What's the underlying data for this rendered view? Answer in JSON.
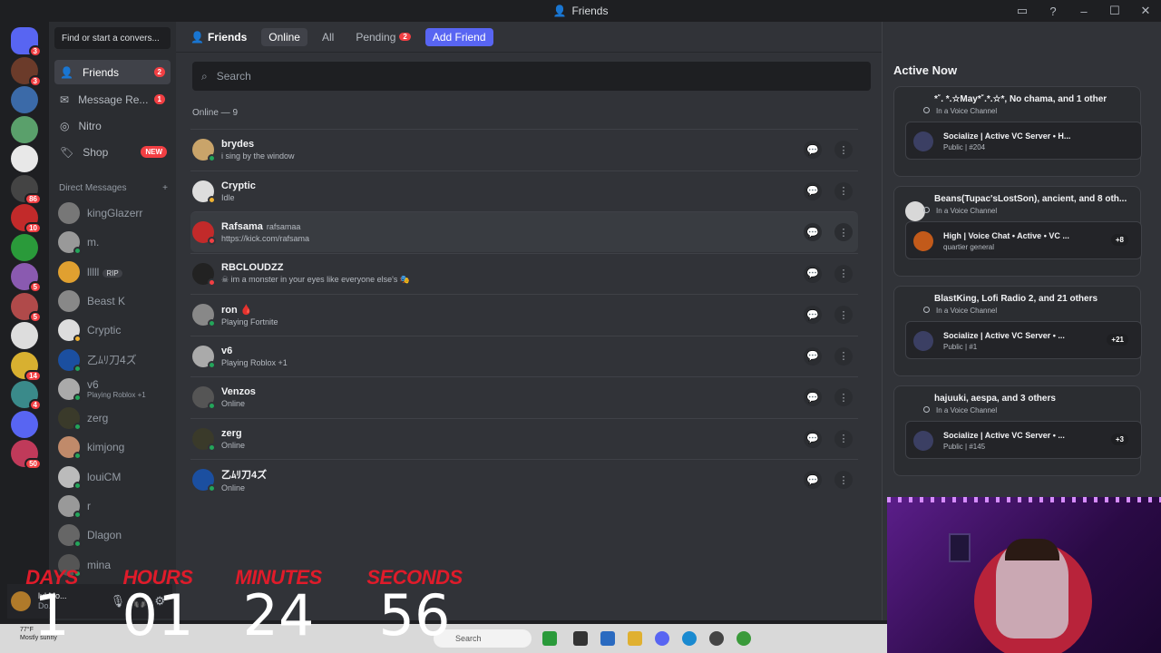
{
  "window": {
    "title": "Friends",
    "buttons": [
      "inbox-icon",
      "help-icon",
      "minimize",
      "maximize",
      "close"
    ]
  },
  "sidebar": {
    "search_placeholder": "Find or start a convers...",
    "nav": [
      {
        "label": "Friends",
        "badge": "2"
      },
      {
        "label": "Message Re...",
        "badge": "1"
      },
      {
        "label": "Nitro",
        "badge": ""
      },
      {
        "label": "Shop",
        "badge": "NEW"
      }
    ],
    "dm_header": "Direct Messages",
    "dms": [
      {
        "name": "kingGlazerr",
        "sub": "",
        "status": "none"
      },
      {
        "name": "m.",
        "sub": "",
        "status": "online"
      },
      {
        "name": "lllll",
        "tag": "RIP",
        "sub": "",
        "status": "none"
      },
      {
        "name": "Beast K",
        "sub": "",
        "status": "none"
      },
      {
        "name": "Cryptic",
        "sub": "",
        "status": "idle"
      },
      {
        "name": "乙ﾑﾘ刀4ズ",
        "sub": "",
        "status": "online"
      },
      {
        "name": "v6",
        "sub": "Playing Roblox +1",
        "status": "online"
      },
      {
        "name": "zerg",
        "sub": "",
        "status": "online"
      },
      {
        "name": "kimjong",
        "sub": "",
        "status": "online"
      },
      {
        "name": "louiCM",
        "sub": "",
        "status": "online"
      },
      {
        "name": "r",
        "sub": "",
        "status": "online"
      },
      {
        "name": "Dlagon",
        "sub": "",
        "status": "online"
      },
      {
        "name": "mina",
        "sub": "",
        "status": "online"
      }
    ],
    "user": {
      "name": "lul Mo...",
      "sub": "Do..."
    }
  },
  "servers": [
    {
      "badge": "3",
      "color": "#5865f2"
    },
    {
      "badge": "3",
      "color": "#6b3b2a"
    },
    {
      "badge": "",
      "color": "#3b6aa8"
    },
    {
      "badge": "",
      "color": "#5aa06b"
    },
    {
      "badge": "",
      "color": "#e8e8e8"
    },
    {
      "badge": "86",
      "color": "#444444"
    },
    {
      "badge": "10",
      "color": "#c22a2a"
    },
    {
      "badge": "",
      "color": "#2a9a3a"
    },
    {
      "badge": "5",
      "color": "#8a5ab0"
    },
    {
      "badge": "5",
      "color": "#b04a4a"
    },
    {
      "badge": "",
      "color": "#dddddd"
    },
    {
      "badge": "14",
      "color": "#d8b030"
    },
    {
      "badge": "4",
      "color": "#3a8a8a"
    },
    {
      "badge": "",
      "color": "#5865f2"
    },
    {
      "badge": "50",
      "color": "#c03a5a"
    }
  ],
  "tabs": {
    "header": "Friends",
    "online": "Online",
    "all": "All",
    "pending": "Pending",
    "pending_badge": "2",
    "add_friend": "Add Friend"
  },
  "friends_search": {
    "placeholder": "Search"
  },
  "online_label": "Online — 9",
  "friends": [
    {
      "name": "brydes",
      "tag": "",
      "status_text": "i sing by the window",
      "status": "online",
      "color": "#c9a46a"
    },
    {
      "name": "Cryptic",
      "tag": "",
      "status_text": "Idle",
      "status": "idle",
      "color": "#dddddd"
    },
    {
      "name": "Rafsama",
      "tag": "rafsamaa",
      "status_text": "https://kick.com/rafsama",
      "status": "dnd",
      "color": "#c22a2a"
    },
    {
      "name": "RBCLOUDZZ",
      "tag": "",
      "status_text": "☠ im a monster in your eyes like everyone else's 🎭",
      "status": "dnd",
      "color": "#222222"
    },
    {
      "name": "ron 🩸",
      "tag": "",
      "status_text": "Playing Fortnite",
      "status": "online",
      "color": "#888888"
    },
    {
      "name": "v6",
      "tag": "",
      "status_text": "Playing Roblox +1",
      "status": "online",
      "color": "#aaaaaa"
    },
    {
      "name": "Venzos",
      "tag": "",
      "status_text": "Online",
      "status": "online",
      "color": "#555555"
    },
    {
      "name": "zerg",
      "tag": "",
      "status_text": "Online",
      "status": "online",
      "color": "#3a3a2a"
    },
    {
      "name": "乙ﾑﾘ刀4ズ",
      "tag": "",
      "status_text": "Online",
      "status": "online",
      "color": "#1b4fa0"
    }
  ],
  "active_now": {
    "title": "Active Now",
    "cards": [
      {
        "title": "*˚. *.☆May*˚.*.☆*, No chama, and 1 other",
        "status": "In a Voice Channel",
        "server": "Socialize | Active VC Server • H...",
        "channel": "Public | #204",
        "extra": ""
      },
      {
        "title": "Beans(Tupac'sLostSon), ancient, and 8 oth...",
        "status": "In a Voice Channel",
        "server": "High | Voice Chat • Active • VC ...",
        "channel": "quartier general",
        "extra": "+8"
      },
      {
        "title": "BlastKing, Lofi Radio 2, and 21 others",
        "status": "In a Voice Channel",
        "server": "Socialize | Active VC Server • ...",
        "channel": "Public | #1",
        "extra": "+21"
      },
      {
        "title": "hajuuki, aespa, and 3 others",
        "status": "In a Voice Channel",
        "server": "Socialize | Active VC Server • ...",
        "channel": "Public | #145",
        "extra": "+3"
      }
    ]
  },
  "countdown": {
    "labels": {
      "days": "DAYS",
      "hours": "HOURS",
      "minutes": "MINUTES",
      "seconds": "SECONDS"
    },
    "values": {
      "days": "1",
      "hours": "01",
      "minutes": "24",
      "seconds": "56"
    }
  },
  "taskbar": {
    "search": "Search",
    "weather_temp": "77°F",
    "weather_desc": "Mostly sunny"
  },
  "colors": {
    "online": "#23a55a",
    "idle": "#f0b232",
    "dnd": "#f23f43",
    "accent": "#5865f2"
  }
}
